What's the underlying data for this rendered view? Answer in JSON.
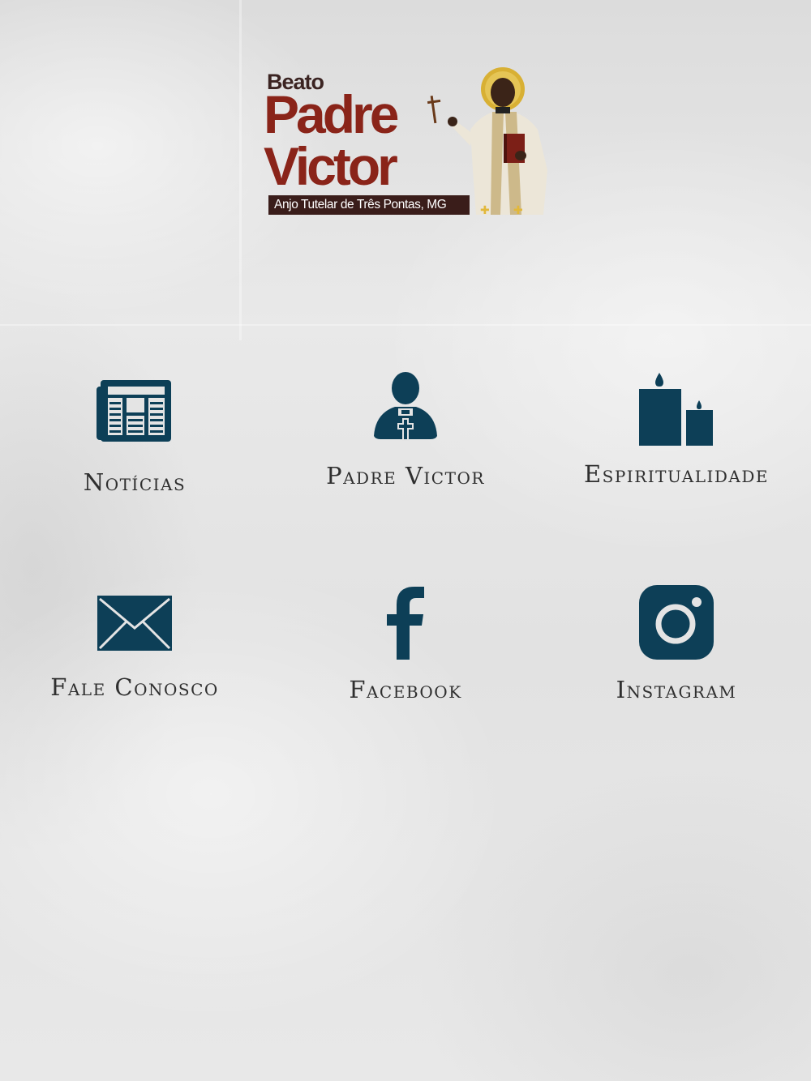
{
  "logo": {
    "line1": "Beato",
    "line2": "Padre",
    "line3": "Victor",
    "tagline": "Anjo Tutelar de Três Pontas, MG"
  },
  "menu": {
    "items": [
      {
        "label": "Notícias",
        "icon": "newspaper-icon"
      },
      {
        "label": "Padre Victor",
        "icon": "priest-icon"
      },
      {
        "label": "Espiritualidade",
        "icon": "candles-icon"
      },
      {
        "label": "Fale Conosco",
        "icon": "envelope-icon"
      },
      {
        "label": "Facebook",
        "icon": "facebook-icon"
      },
      {
        "label": "Instagram",
        "icon": "instagram-icon"
      }
    ]
  },
  "colors": {
    "icon": "#0d3f57",
    "brand": "#8a2419",
    "label": "#2f2f2f"
  }
}
